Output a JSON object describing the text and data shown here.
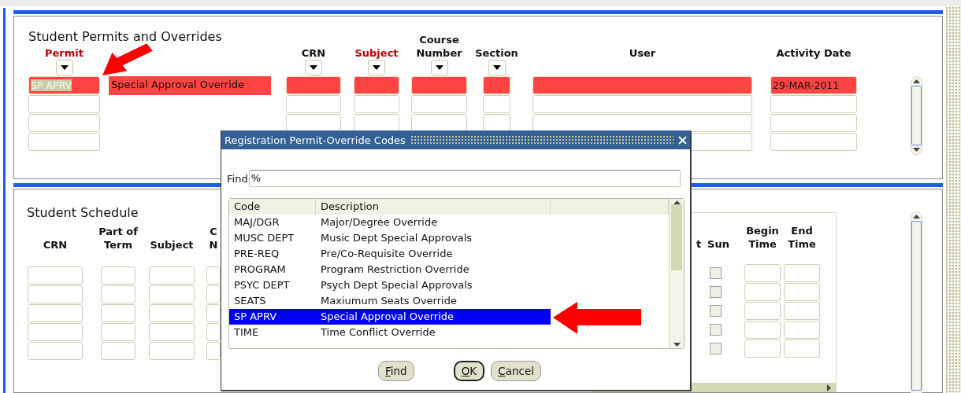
{
  "permits": {
    "title": "Student Permits and Overrides",
    "columns": [
      {
        "label_lines": [
          "Permit"
        ],
        "required": true,
        "dropdown": true
      },
      {
        "label_lines": [
          "CRN"
        ],
        "required": false,
        "dropdown": true
      },
      {
        "label_lines": [
          "Subject"
        ],
        "required": true,
        "dropdown": true
      },
      {
        "label_lines": [
          "Course",
          "Number"
        ],
        "required": false,
        "dropdown": true
      },
      {
        "label_lines": [
          "Section"
        ],
        "required": false,
        "dropdown": true
      },
      {
        "label_lines": [
          "User"
        ],
        "required": false,
        "dropdown": false
      },
      {
        "label_lines": [
          "Activity Date"
        ],
        "required": false,
        "dropdown": false
      }
    ],
    "rows": [
      {
        "current": true,
        "text_selected": true,
        "permit": "SP APRV",
        "description": "Special Approval Override",
        "activity_date": "29-MAR-2011"
      },
      {
        "current": false
      },
      {
        "current": false
      },
      {
        "current": false
      }
    ]
  },
  "schedule": {
    "title": "Student Schedule",
    "left_columns": [
      {
        "kind": "field",
        "label_lines": [
          "CRN"
        ]
      },
      {
        "kind": "field",
        "label_lines": [
          "Part of",
          "Term"
        ]
      },
      {
        "kind": "field",
        "label_lines": [
          "Subject"
        ]
      },
      {
        "kind": "field",
        "label_lines": [
          "C",
          "N"
        ]
      }
    ],
    "right_columns": [
      {
        "kind": "label",
        "label_lines": [
          "t"
        ]
      },
      {
        "kind": "checkbox",
        "label_lines": [
          "Sun"
        ]
      },
      {
        "kind": "field",
        "label_lines": [
          "Begin",
          "Time"
        ]
      },
      {
        "kind": "field",
        "label_lines": [
          "End",
          "Time"
        ]
      }
    ],
    "rows": [
      {
        "current": false,
        "checked": false
      },
      {
        "current": false,
        "checked": false
      },
      {
        "current": false,
        "checked": false
      },
      {
        "current": false,
        "checked": false
      },
      {
        "current": false,
        "checked": false
      }
    ]
  },
  "dialog": {
    "title": "Registration Permit-Override Codes",
    "find": {
      "label": "Find",
      "value": "%"
    },
    "columns": [
      "Code",
      "Description"
    ],
    "rows": [
      {
        "code": "MAJ/DGR",
        "description": "Major/Degree Override",
        "selected": false
      },
      {
        "code": "MUSC DEPT",
        "description": "Music Dept Special Approvals",
        "selected": false
      },
      {
        "code": "PRE-REQ",
        "description": "Pre/Co-Requisite Override",
        "selected": false
      },
      {
        "code": "PROGRAM",
        "description": "Program Restriction Override",
        "selected": false
      },
      {
        "code": "PSYC DEPT",
        "description": "Psych Dept Special Approvals",
        "selected": false
      },
      {
        "code": "SEATS",
        "description": "Maxiumum Seats Override",
        "selected": false
      },
      {
        "code": "SP APRV",
        "description": "Special Approval Override",
        "selected": true
      },
      {
        "code": "TIME",
        "description": "Time Conflict Override",
        "selected": false
      }
    ],
    "buttons": [
      {
        "label": "Find",
        "default": false
      },
      {
        "label": "OK",
        "default": true
      },
      {
        "label": "Cancel",
        "default": false
      }
    ]
  }
}
